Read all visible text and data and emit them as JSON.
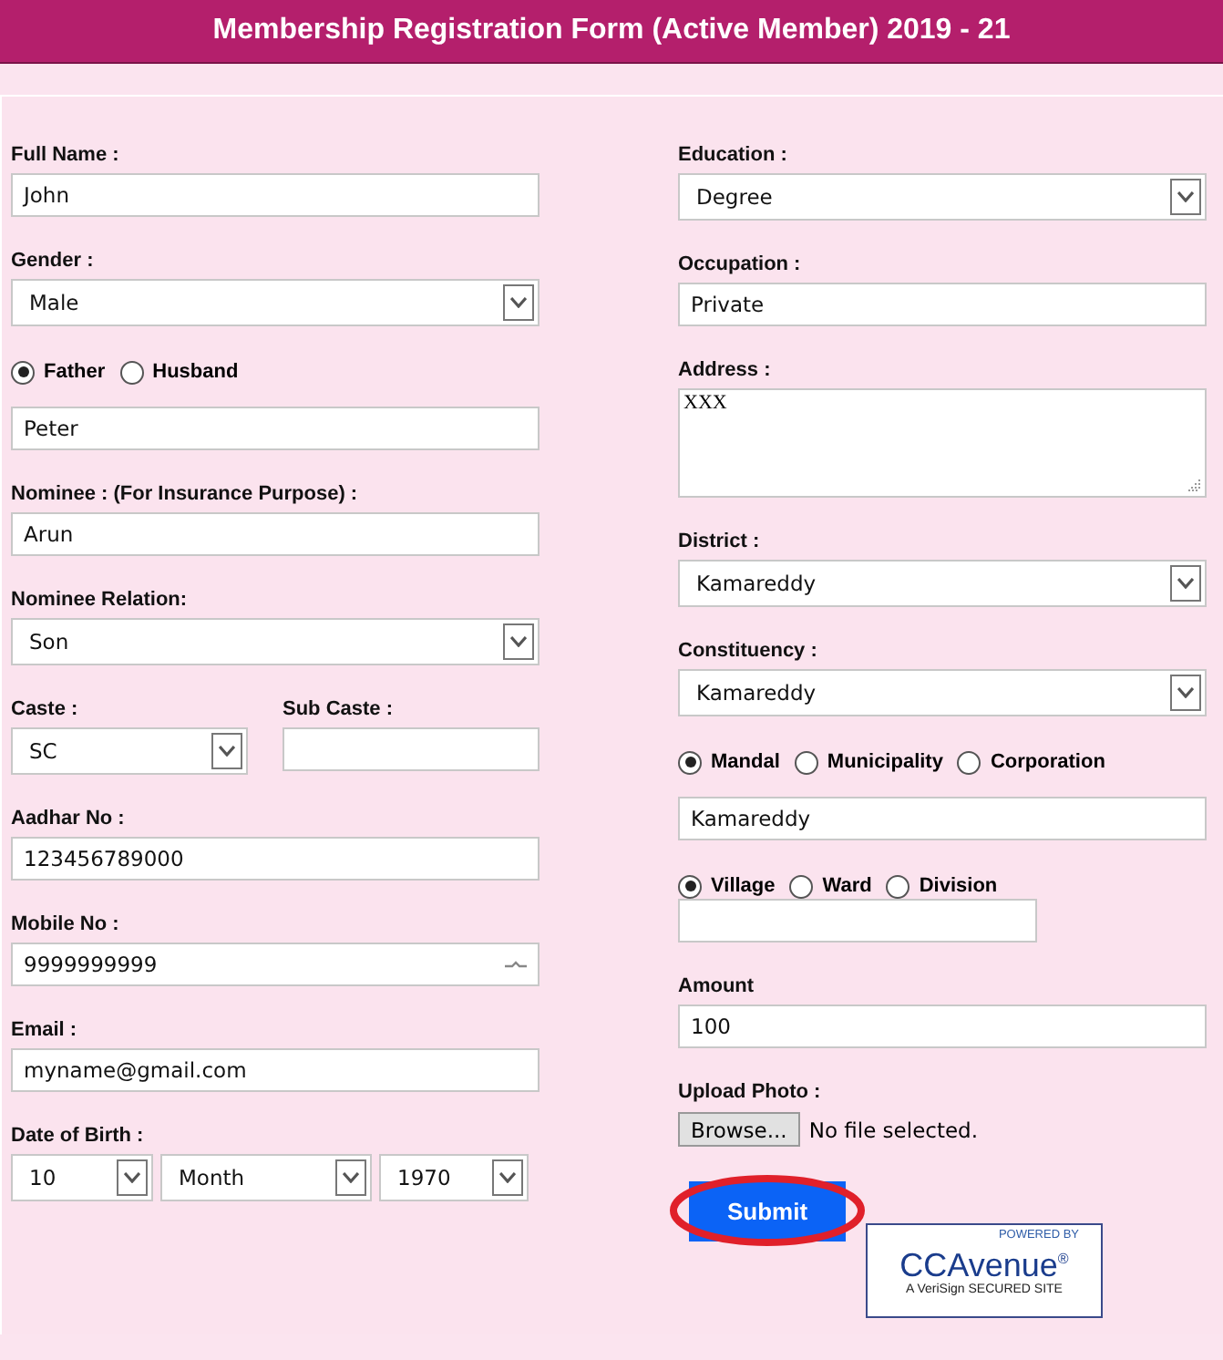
{
  "title": "Membership Registration Form (Active Member) 2019 - 21",
  "left": [
    {
      "kind": "text",
      "label": "Full Name :",
      "value": "John"
    },
    {
      "kind": "select",
      "label": "Gender :",
      "value": "Male"
    },
    {
      "kind": "radio_text",
      "options": [
        {
          "label": "Father",
          "selected": true
        },
        {
          "label": "Husband",
          "selected": false
        }
      ],
      "value": "Peter"
    },
    {
      "kind": "text",
      "label": "Nominee : (For Insurance Purpose) :",
      "value": "Arun"
    },
    {
      "kind": "select",
      "label": "Nominee Relation:",
      "value": "Son"
    },
    {
      "kind": "pair",
      "fields": [
        {
          "kind": "select",
          "label": "Caste :",
          "value": "SC"
        },
        {
          "kind": "text",
          "label": "Sub Caste :"
        }
      ]
    },
    {
      "kind": "text",
      "label": "Aadhar No :",
      "value": "123456789000"
    },
    {
      "kind": "number",
      "label": "Mobile No :",
      "value": "9999999999"
    },
    {
      "kind": "text",
      "label": "Email :",
      "value": "myname@gmail.com"
    },
    {
      "kind": "date",
      "label": "Date of Birth :",
      "parts": [
        "10",
        "Month",
        "1970"
      ]
    }
  ],
  "right": [
    {
      "kind": "select",
      "label": "Education :",
      "value": "Degree"
    },
    {
      "kind": "text",
      "label": "Occupation :",
      "value": "Private"
    },
    {
      "kind": "textarea",
      "label": "Address :",
      "value": "XXX"
    },
    {
      "kind": "select",
      "label": "District :",
      "value": "Kamareddy"
    },
    {
      "kind": "select",
      "label": "Constituency :",
      "value": "Kamareddy"
    },
    {
      "kind": "radio_text",
      "options": [
        {
          "label": "Mandal",
          "selected": true
        },
        {
          "label": "Municipality",
          "selected": false
        },
        {
          "label": "Corporation",
          "selected": false
        }
      ],
      "value": "Kamareddy"
    },
    {
      "kind": "radio_text",
      "options": [
        {
          "label": "Village",
          "selected": true
        },
        {
          "label": "Ward",
          "selected": false
        },
        {
          "label": "Division",
          "selected": false
        }
      ]
    },
    {
      "kind": "text",
      "label": "Amount",
      "value": "100"
    },
    {
      "kind": "file",
      "label": "Upload Photo :",
      "button": "Browse...",
      "status": "No file selected."
    }
  ],
  "submit": {
    "label": "Submit",
    "circled": true
  },
  "badge": {
    "top": "POWERED BY",
    "brand": "CCAvenue$^{®}$",
    "footer": "A VeriSign SECURED SITE"
  }
}
